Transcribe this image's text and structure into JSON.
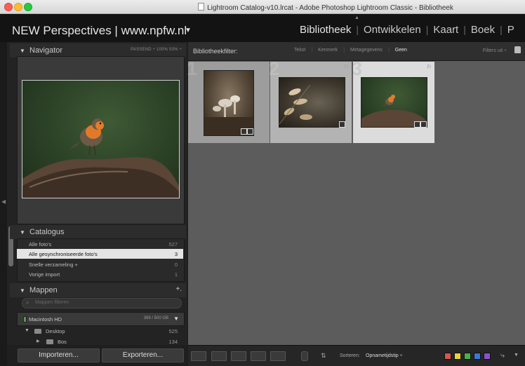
{
  "window": {
    "title": "Lightroom Catalog-v10.lrcat - Adobe Photoshop Lightroom Classic - Bibliotheek"
  },
  "identity_plate": "NEW Perspectives | www.npfw.nl",
  "modules": [
    "Bibliotheek",
    "Ontwikkelen",
    "Kaart",
    "Boek",
    "P"
  ],
  "active_module": "Bibliotheek",
  "navigator": {
    "title": "Navigator",
    "zoom_options": "PASSEND ÷   100%   50% ÷"
  },
  "catalog": {
    "title": "Catalogus",
    "items": [
      {
        "label": "Alle foto's",
        "count": "527"
      },
      {
        "label": "Alle gesynchroniseerde foto's",
        "count": "3"
      },
      {
        "label": "Snelle verzameling +",
        "count": "0"
      },
      {
        "label": "Vorige import",
        "count": "1"
      }
    ]
  },
  "folders": {
    "title": "Mappen",
    "add": "+.",
    "search_placeholder": "Mappen filteren",
    "volume": {
      "name": "Macintosh HD",
      "size": "389 / 500 GB"
    },
    "items": [
      {
        "label": "Desktop",
        "count": "525"
      },
      {
        "label": "Bos",
        "count": "134"
      }
    ]
  },
  "buttons": {
    "import": "Importeren...",
    "export": "Exporteren..."
  },
  "filter_bar": {
    "label": "Bibliotheekfilter:",
    "options": [
      "Tekst",
      "Kenmerk",
      "Metagegevens",
      "Geen"
    ],
    "active": "Geen",
    "filters_off": "Filters uit ÷"
  },
  "grid": {
    "cells": [
      {
        "index": "1",
        "subject": "mushrooms"
      },
      {
        "index": "2",
        "subject": "grass-seeds"
      },
      {
        "index": "3",
        "subject": "robin-on-branch"
      }
    ]
  },
  "toolbar": {
    "sort_label": "Sorteren:",
    "sort_value": "Opnametijdstip ÷"
  },
  "colors": {
    "label_red": "#d9534f",
    "label_yellow": "#e8d23c",
    "label_green": "#4cae4c",
    "label_blue": "#3a78d6",
    "label_purple": "#8a52c9"
  }
}
